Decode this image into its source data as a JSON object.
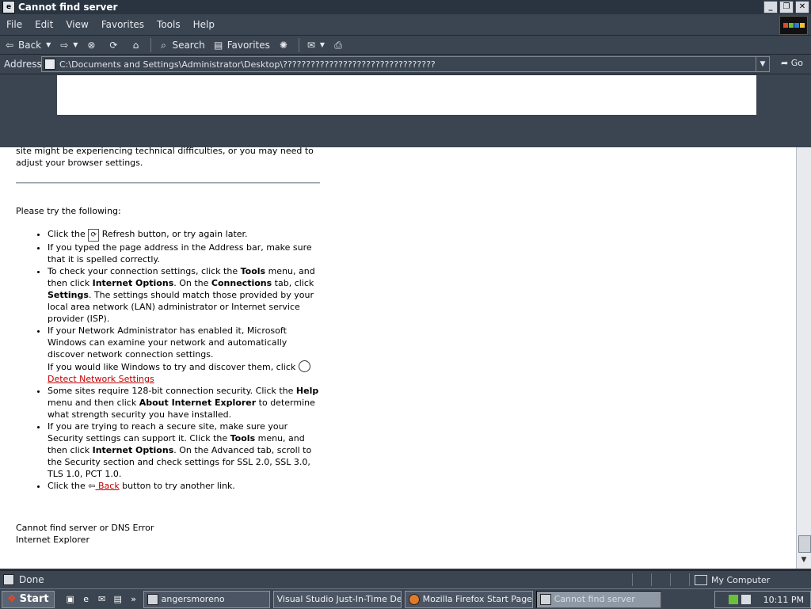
{
  "window": {
    "title": "Cannot find server",
    "controls": [
      "minimize",
      "restore",
      "close"
    ]
  },
  "menu": [
    "File",
    "Edit",
    "View",
    "Favorites",
    "Tools",
    "Help"
  ],
  "toolbar": {
    "back": "Back",
    "search": "Search",
    "favorites": "Favorites"
  },
  "address": {
    "label": "Address",
    "url": "C:\\Documents and Settings\\Administrator\\Desktop\\?????????????????????????????????",
    "go": "Go"
  },
  "page": {
    "intro": "site might be experiencing technical difficulties, or you may need to adjust your browser settings.",
    "try_heading": "Please try the following:",
    "items": [
      {
        "pre": "Click the ",
        "post": " Refresh button, or try again later."
      },
      {
        "text": "If you typed the page address in the Address bar, make sure that it is spelled correctly."
      },
      {
        "parts": [
          "To check your connection settings, click the ",
          "Tools",
          " menu, and then click ",
          "Internet Options",
          ". On the ",
          "Connections",
          " tab, click ",
          "Settings",
          ". The settings should match those provided by your local area network (LAN) administrator or Internet service provider (ISP)."
        ]
      },
      {
        "text": "If your Network Administrator has enabled it, Microsoft Windows can examine your network and automatically discover network connection settings.",
        "text2": "If you would like Windows to try and discover them, click",
        "link": " Detect Network Settings"
      },
      {
        "parts": [
          "Some sites require 128-bit connection security. Click the ",
          "Help",
          " menu and then click ",
          "About Internet Explorer",
          " to determine what strength security you have installed."
        ]
      },
      {
        "parts": [
          "If you are trying to reach a secure site, make sure your Security settings can support it. Click the ",
          "Tools",
          " menu, and then click ",
          "Internet Options",
          ". On the Advanced tab, scroll to the Security section and check settings for SSL 2.0, SSL 3.0, TLS 1.0, PCT 1.0."
        ]
      },
      {
        "pre": "Click the ",
        "link": " Back",
        "post": " button to try another link."
      }
    ],
    "footer_line1": "Cannot find server or DNS Error",
    "footer_line2": "Internet Explorer"
  },
  "status": {
    "text": "Done",
    "zone": "My Computer"
  },
  "taskbar": {
    "start": "Start",
    "tasks": [
      "angersmoreno",
      "Visual Studio Just-In-Time De...",
      "Mozilla Firefox Start Page...",
      "Cannot find server"
    ],
    "clock": "10:11 PM"
  }
}
